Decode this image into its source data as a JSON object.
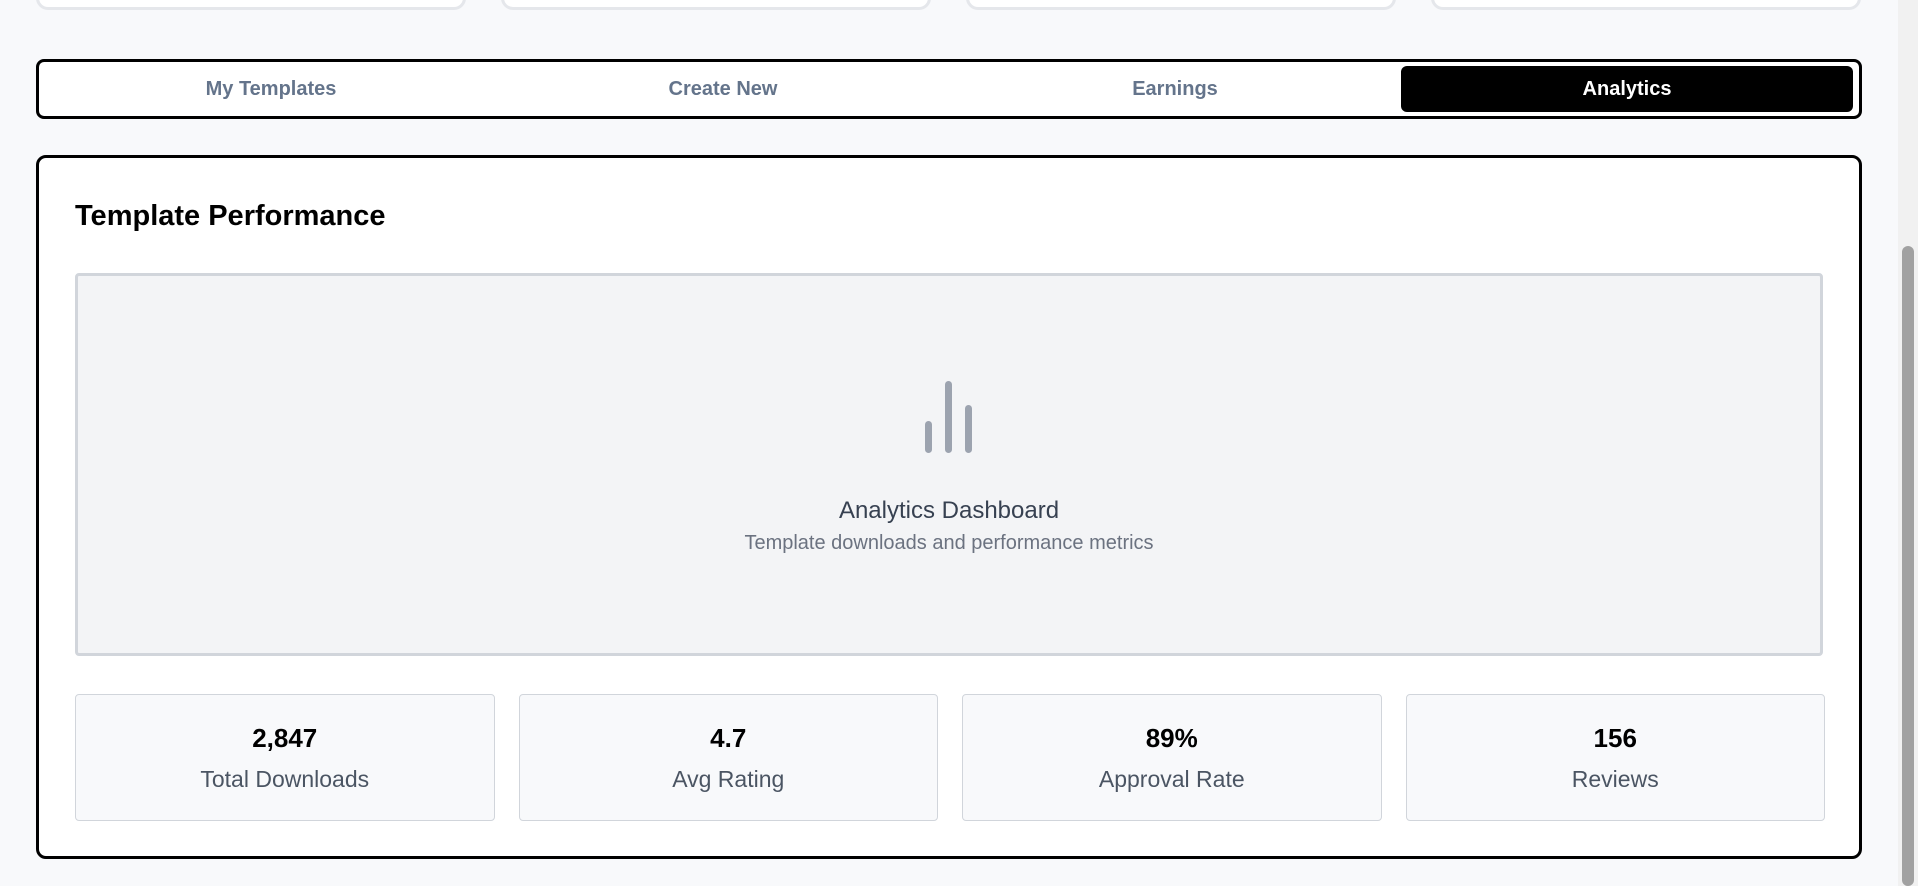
{
  "tabs": [
    {
      "label": "My Templates",
      "active": false
    },
    {
      "label": "Create New",
      "active": false
    },
    {
      "label": "Earnings",
      "active": false
    },
    {
      "label": "Analytics",
      "active": true
    }
  ],
  "panel": {
    "title": "Template Performance",
    "placeholder": {
      "icon": "bar-chart-icon",
      "title": "Analytics Dashboard",
      "subtitle": "Template downloads and performance metrics"
    },
    "stats": [
      {
        "value": "2,847",
        "label": "Total Downloads"
      },
      {
        "value": "4.7",
        "label": "Avg Rating"
      },
      {
        "value": "89%",
        "label": "Approval Rate"
      },
      {
        "value": "156",
        "label": "Reviews"
      }
    ]
  },
  "colors": {
    "active_tab_bg": "#000000",
    "inactive_tab_text": "#64748b",
    "placeholder_bg": "#f3f4f6",
    "icon": "#9ca3af"
  }
}
